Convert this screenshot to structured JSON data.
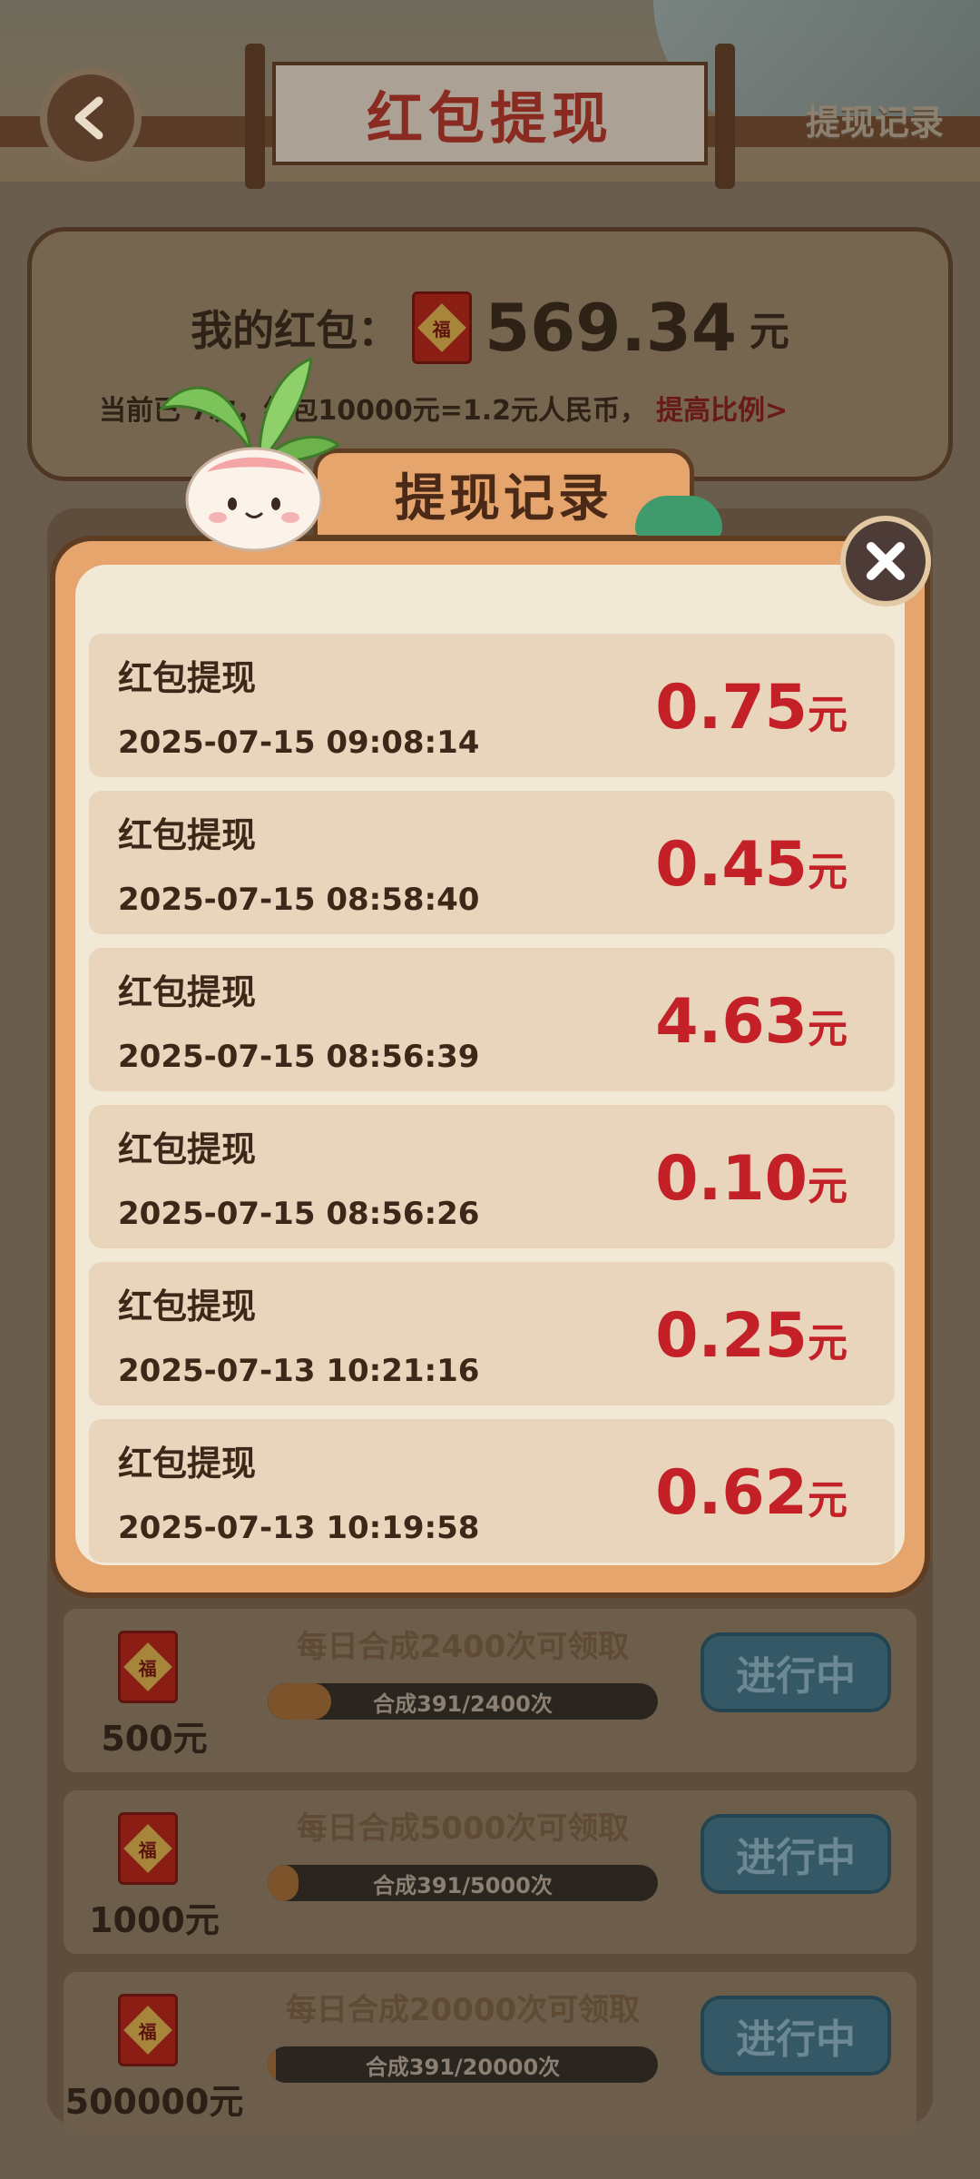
{
  "header": {
    "title": "红包提现",
    "record_link": "提现记录"
  },
  "wallet": {
    "label": "我的红包：",
    "amount": "569.34",
    "unit": "元",
    "ratio_text": "当前已 7次，红包10000元=1.2元人民币，",
    "raise_link": "提高比例>",
    "fu_char": "福"
  },
  "tasks": [
    {
      "reward": "500元",
      "title": "每日合成2400次可领取",
      "progress_text": "合成391/2400次",
      "progress_fraction": 0.163,
      "button": "进行中"
    },
    {
      "reward": "1000元",
      "title": "每日合成5000次可领取",
      "progress_text": "合成391/5000次",
      "progress_fraction": 0.078,
      "button": "进行中"
    },
    {
      "reward": "500000元",
      "title": "每日合成20000次可领取",
      "progress_text": "合成391/20000次",
      "progress_fraction": 0.02,
      "button": "进行中"
    }
  ],
  "modal": {
    "title": "提现记录",
    "records": [
      {
        "title": "红包提现",
        "time": "2025-07-15 09:08:14",
        "amount": "0.75",
        "unit": "元"
      },
      {
        "title": "红包提现",
        "time": "2025-07-15 08:58:40",
        "amount": "0.45",
        "unit": "元"
      },
      {
        "title": "红包提现",
        "time": "2025-07-15 08:56:39",
        "amount": "4.63",
        "unit": "元"
      },
      {
        "title": "红包提现",
        "time": "2025-07-15 08:56:26",
        "amount": "0.10",
        "unit": "元"
      },
      {
        "title": "红包提现",
        "time": "2025-07-13 10:21:16",
        "amount": "0.25",
        "unit": "元"
      },
      {
        "title": "红包提现",
        "time": "2025-07-13 10:19:58",
        "amount": "0.62",
        "unit": "元"
      }
    ]
  },
  "icons": {
    "back": "back-arrow-icon",
    "close": "close-icon",
    "hongbao": "red-envelope-icon",
    "mascot": "radish-mascot"
  },
  "colors": {
    "amount_red": "#c32127",
    "modal_orange": "#e6a56c",
    "modal_cream": "#f1e8d6",
    "row_beige": "#e8d5bc"
  }
}
